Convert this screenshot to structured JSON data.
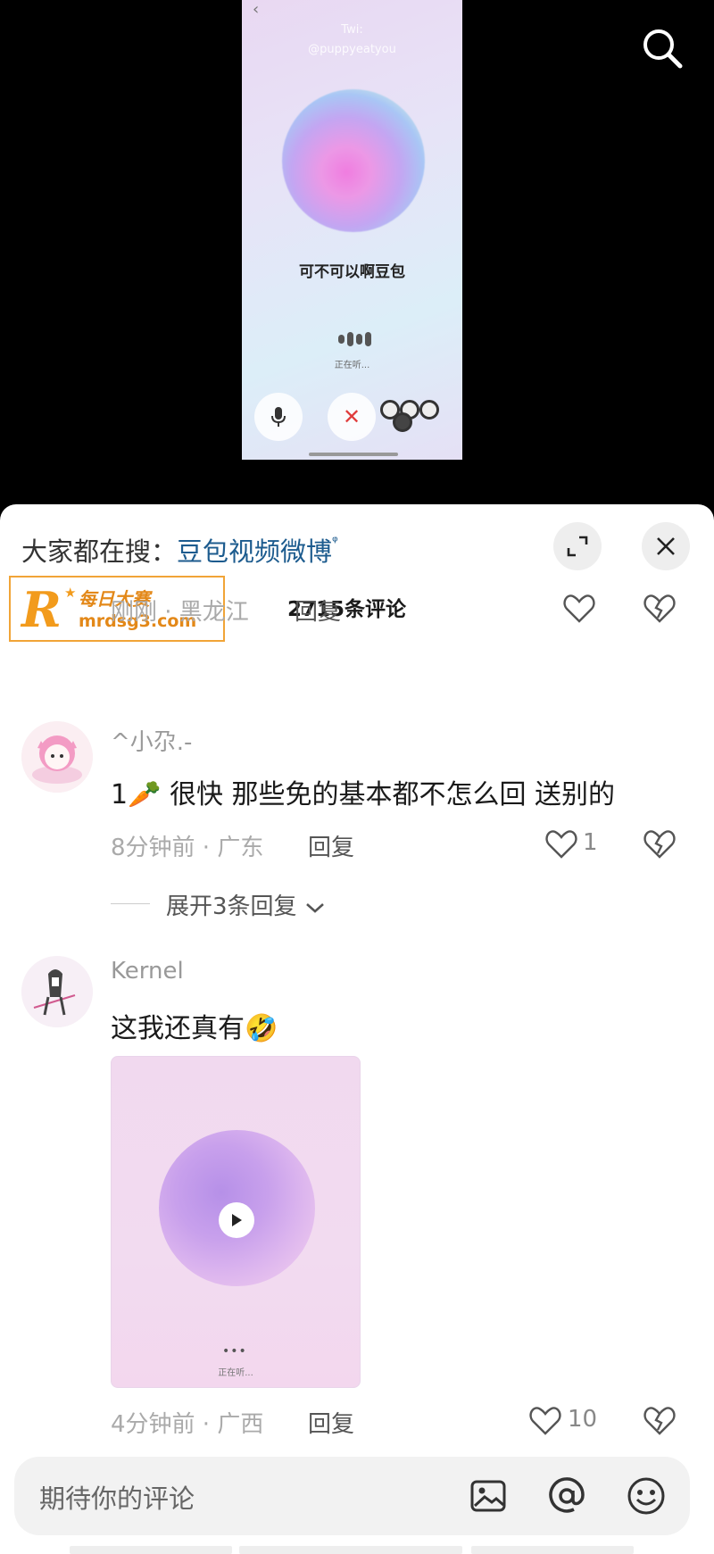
{
  "video": {
    "back_glyph": "‹",
    "watermark_line1": "Twi:",
    "watermark_line2": "@puppyeatyou",
    "speech_text": "可不可以啊豆包",
    "listening_text": "正在听...",
    "close_glyph": "✕"
  },
  "panel": {
    "hot_search_prefix": "大家都在搜：",
    "hot_search_keyword": "豆包视频微博",
    "hot_search_icon": "ᵠ",
    "comment_count": "2715条评论",
    "logo": {
      "letter": "R",
      "star": "★",
      "name": "每日大赛",
      "url": "mrdsg3.com"
    }
  },
  "comments": [
    {
      "meta": "刚刚 · 黑龙江",
      "reply_label": "回复",
      "likes": ""
    },
    {
      "username": "^小尕.-",
      "content": "1🥕 很快 那些免的基本都不怎么回 送别的",
      "meta": "8分钟前 · 广东",
      "reply_label": "回复",
      "likes": "1",
      "expand_replies": "展开3条回复"
    },
    {
      "username": "Kernel",
      "content": "这我还真有🤣",
      "attachment_dots": "•••",
      "attachment_text": "正在听...",
      "meta": "4分钟前 · 广西",
      "reply_label": "回复",
      "likes": "10"
    }
  ],
  "input": {
    "placeholder": "期待你的评论"
  },
  "colors": {
    "keyword": "#1c5b8e",
    "logo_orange": "#f29b1c",
    "close_red": "#e03c3c"
  },
  "icons": [
    "search-icon",
    "expand-icon",
    "close-icon",
    "heart-icon",
    "broken-heart-icon",
    "image-icon",
    "at-icon",
    "emoji-icon",
    "mic-icon",
    "play-icon"
  ]
}
